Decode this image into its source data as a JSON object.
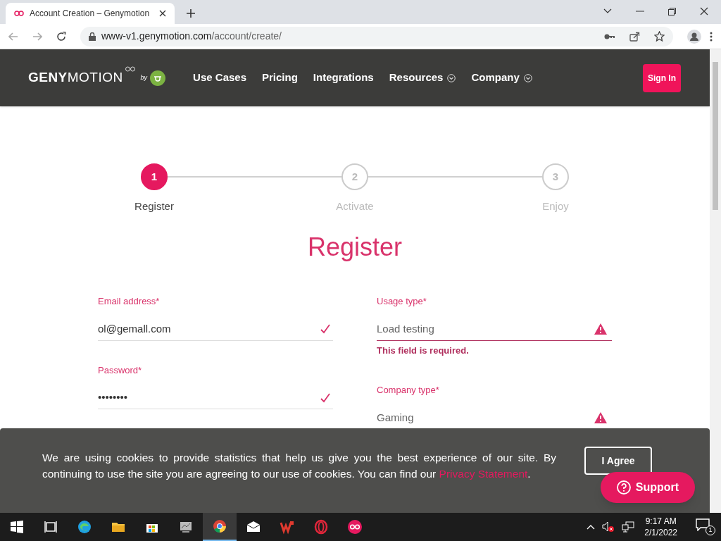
{
  "browser": {
    "tab_title": "Account Creation – Genymotion",
    "url_host": "www-v1.genymotion.com",
    "url_path": "/account/create/"
  },
  "nav": {
    "logo": "**GENY**MOTION",
    "logo_by": "by",
    "items": [
      {
        "label": "Use Cases",
        "dropdown": false
      },
      {
        "label": "Pricing",
        "dropdown": false
      },
      {
        "label": "Integrations",
        "dropdown": false
      },
      {
        "label": "Resources",
        "dropdown": true
      },
      {
        "label": "Company",
        "dropdown": true
      }
    ],
    "sign_in": "Sign In"
  },
  "steps": [
    {
      "number": "1",
      "label": "Register",
      "selected": true
    },
    {
      "number": "2",
      "label": "Activate",
      "selected": false
    },
    {
      "number": "3",
      "label": "Enjoy",
      "selected": false
    }
  ],
  "heading": "Register",
  "left_fields": [
    {
      "label": "Email address*",
      "value": "ol@gemall.com",
      "invalid": false
    },
    {
      "label": "Password*",
      "value": "••••••••",
      "invalid": false
    }
  ],
  "right_fields": [
    {
      "label": "Usage type*",
      "value": "Load testing",
      "invalid": true,
      "error": "This field is required."
    },
    {
      "label": "Company type*",
      "value": "Gaming",
      "invalid": true
    }
  ],
  "cookie": {
    "text": "We are using cookies to provide statistics that help us give you the best experience of our site. By continuing to use the site you are agreeing to our use of cookies. You can find our",
    "link": "Privacy Statement",
    "end": ".",
    "agree": "I Agree"
  },
  "support": "Support",
  "taskbar": {
    "time": "9:17 AM",
    "date": "2/1/2022",
    "notifications": "1"
  }
}
